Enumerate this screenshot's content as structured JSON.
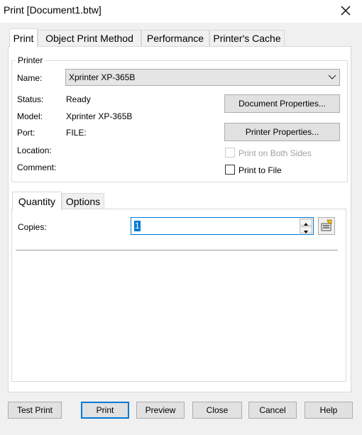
{
  "window": {
    "title": "Print [Document1.btw]"
  },
  "tabs": [
    "Print",
    "Object Print Method",
    "Performance",
    "Printer's Cache"
  ],
  "printer_group": {
    "label": "Printer",
    "name_label": "Name:",
    "name_value": "Xprinter XP-365B",
    "status_label": "Status:",
    "status_value": "Ready",
    "model_label": "Model:",
    "model_value": "Xprinter XP-365B",
    "port_label": "Port:",
    "port_value": "FILE:",
    "location_label": "Location:",
    "comment_label": "Comment:",
    "doc_props_button": "Document Properties...",
    "printer_props_button": "Printer Properties...",
    "both_sides_label": "Print on Both Sides",
    "print_to_file_label": "Print to File"
  },
  "inner_tabs": [
    "Quantity",
    "Options"
  ],
  "quantity": {
    "copies_label": "Copies:",
    "copies_value": "1"
  },
  "buttons": {
    "test_print": "Test Print",
    "print": "Print",
    "preview": "Preview",
    "close": "Close",
    "cancel": "Cancel",
    "help": "Help"
  },
  "icons": [
    "close-icon",
    "chevron-down-icon",
    "spin-up-icon",
    "spin-down-icon",
    "copies-settings-icon"
  ]
}
